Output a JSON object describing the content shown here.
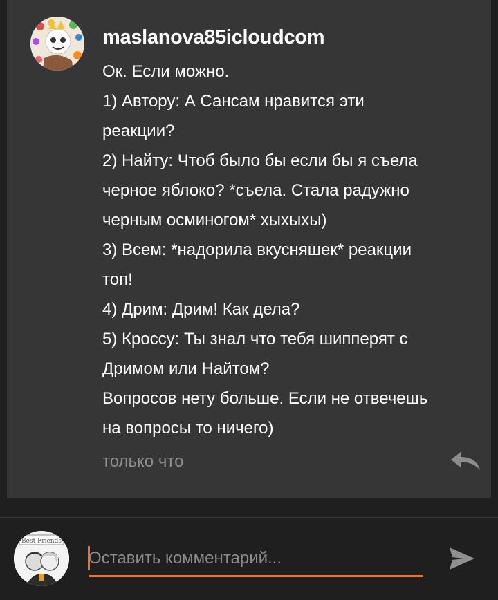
{
  "comment": {
    "username": "maslanova85icloudcom",
    "lines": [
      "Ок. Если можно.",
      "1) Автору: А Сансам нравится эти",
      "реакции?",
      "2) Найту: Чтоб было бы если бы я съела",
      "черное яблоко? *съела. Стала радужно",
      "черным осминогом* хыхыхы)",
      "3) Всем: *надорила вкусняшек* реакции",
      "топ!",
      "4) Дрим: Дрим! Как дела?",
      "5) Кроссу: Ты знал что тебя шипперят с",
      "Дримом или Найтом?",
      "Вопросов нету больше. Если не отвечешь",
      "на вопросы то ничего)"
    ],
    "timestamp": "только что",
    "avatar_icon": "user-avatar-icon",
    "reply_icon": "reply-arrow-icon"
  },
  "composer": {
    "placeholder": "Оставить комментарий...",
    "value": "",
    "send_icon": "send-icon",
    "avatar_icon": "own-avatar-icon"
  },
  "colors": {
    "background": "#1f1f1f",
    "card": "#363636",
    "accent": "#e8762a",
    "muted_text": "#8c8c8c"
  }
}
